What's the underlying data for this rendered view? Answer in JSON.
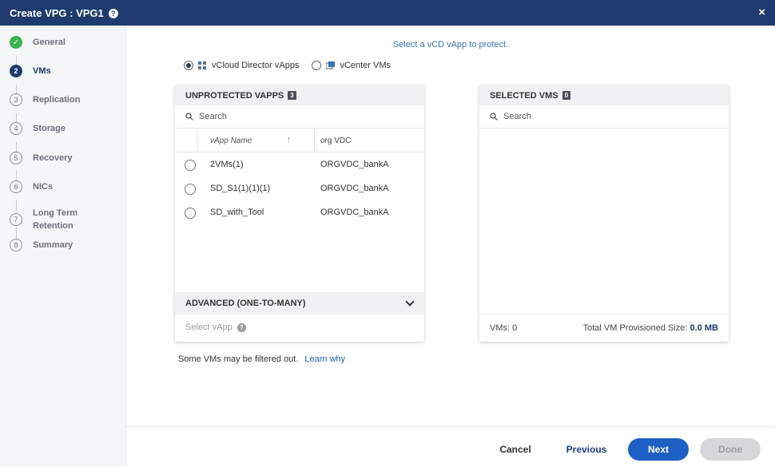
{
  "window": {
    "title": "Create VPG : VPG1",
    "help_glyph": "?",
    "close_glyph": "×"
  },
  "sidebar": {
    "steps": [
      {
        "num": "✓",
        "label": "General",
        "state": "done"
      },
      {
        "num": "2",
        "label": "VMs",
        "state": "current"
      },
      {
        "num": "3",
        "label": "Replication",
        "state": "pending"
      },
      {
        "num": "4",
        "label": "Storage",
        "state": "pending"
      },
      {
        "num": "5",
        "label": "Recovery",
        "state": "pending"
      },
      {
        "num": "6",
        "label": "NICs",
        "state": "pending"
      },
      {
        "num": "7",
        "label": "Long Term",
        "label2": "Retention",
        "state": "pending"
      },
      {
        "num": "8",
        "label": "Summary",
        "state": "pending"
      }
    ]
  },
  "main": {
    "subtitle": "Select a vCD vApp to protect.",
    "radio": {
      "option1": "vCloud Director vApps",
      "option2": "vCenter VMs",
      "selected": "option1"
    },
    "left_panel": {
      "title": "UNPROTECTED VAPPS",
      "count": "3",
      "search_placeholder": "Search",
      "columns": {
        "name": "vApp Name",
        "sort_glyph": "↑",
        "vdc": "org VDC"
      },
      "rows": [
        {
          "name": "2VMs(1)",
          "vdc": "ORGVDC_bankA"
        },
        {
          "name": "SD_S1(1)(1)(1)",
          "vdc": "ORGVDC_bankA"
        },
        {
          "name": "SD_with_Tool",
          "vdc": "ORGVDC_bankA"
        }
      ],
      "advanced": "ADVANCED (ONE-TO-MANY)",
      "select_vapp": "Select vApp",
      "help_glyph": "?"
    },
    "right_panel": {
      "title": "SELECTED VMS",
      "count": "0",
      "search_placeholder": "Search",
      "vms_label": "VMs: 0",
      "size_label": "Total VM Provisioned Size:",
      "size_value": "0.0 MB"
    },
    "note": {
      "text": "Some VMs may be filtered out.",
      "link": "Learn why"
    }
  },
  "footer": {
    "cancel": "Cancel",
    "previous": "Previous",
    "next": "Next",
    "done": "Done"
  },
  "colors": {
    "header": "#1e3a6e",
    "accent": "#1d5fc4",
    "done": "#37b24d",
    "link": "#1e5fb0"
  }
}
